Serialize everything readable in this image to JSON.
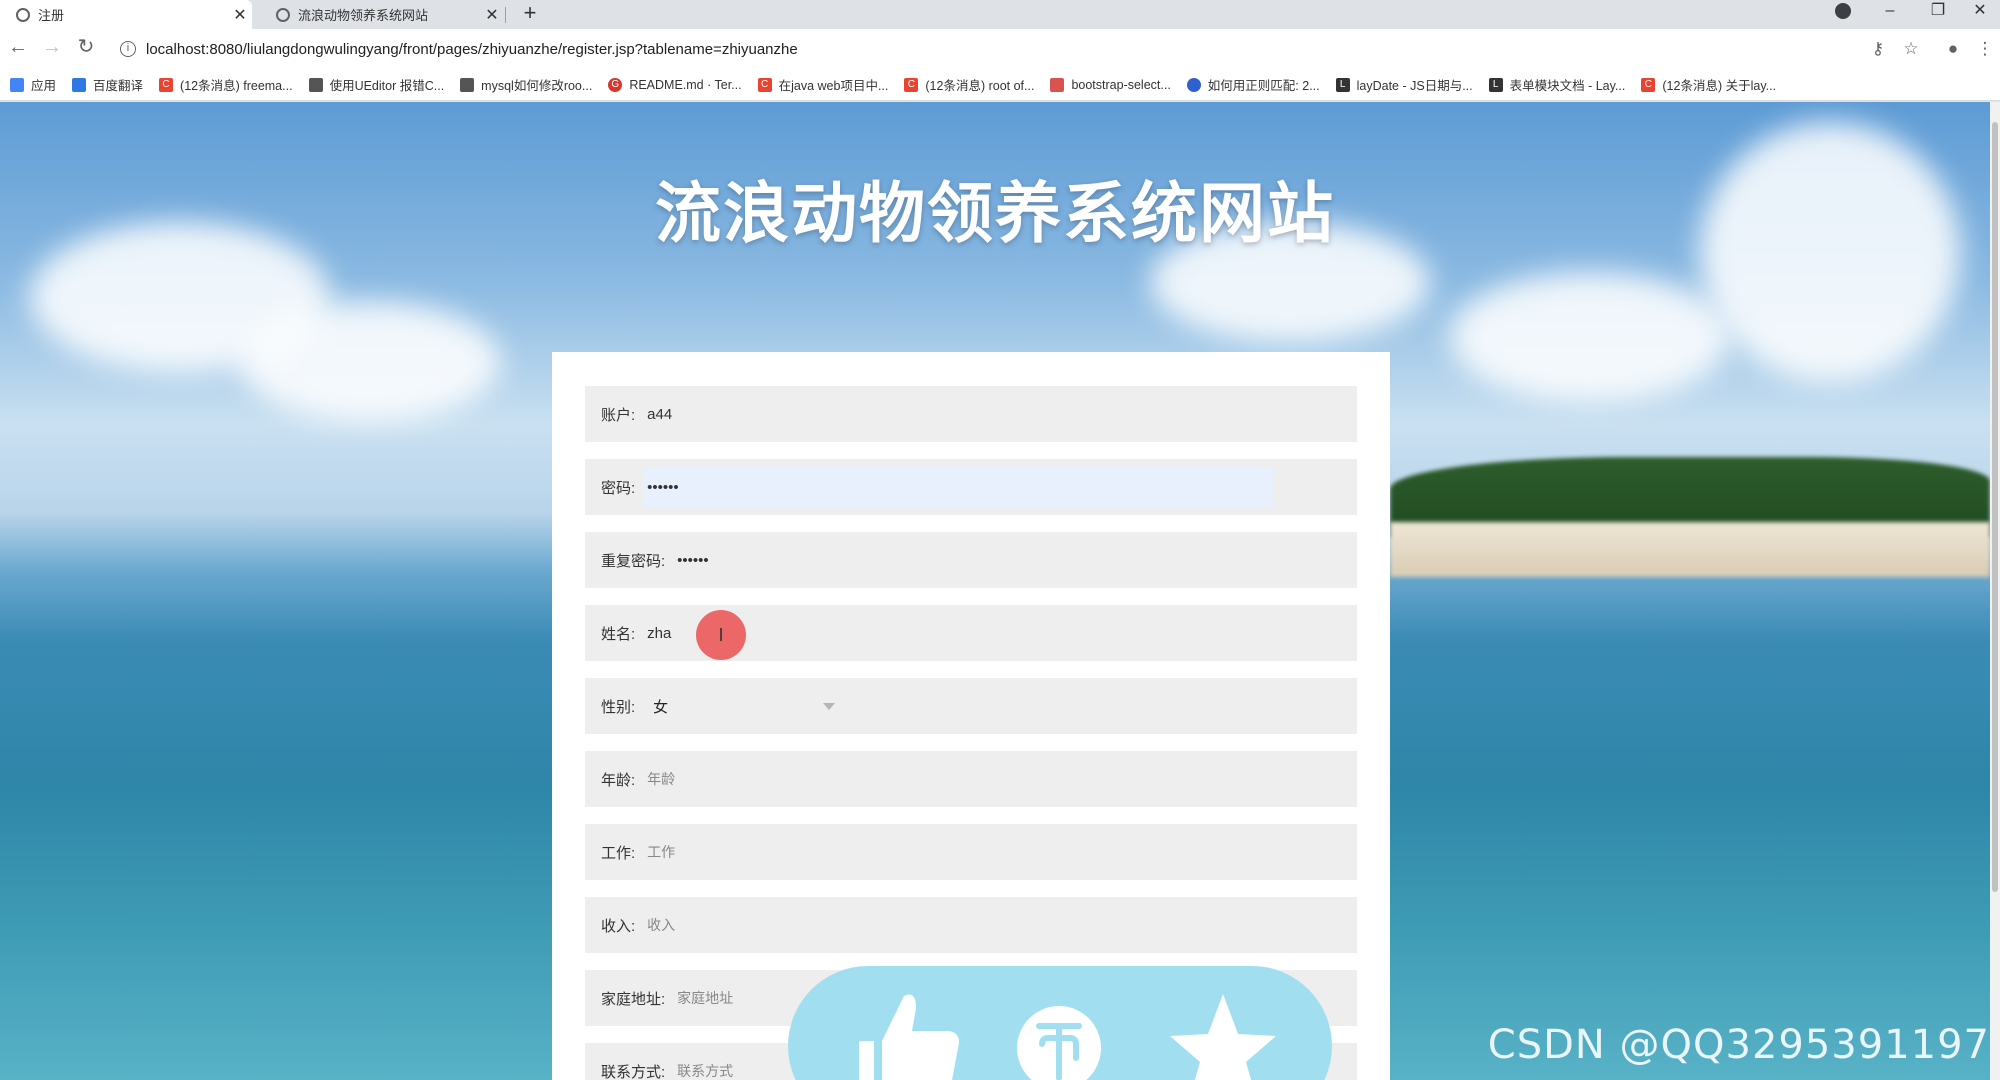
{
  "browser": {
    "tabs": [
      {
        "title": "注册",
        "active": true
      },
      {
        "title": "流浪动物领养系统网站",
        "active": false
      }
    ],
    "new_tab": "+",
    "url": "localhost:8080/liulangdongwulingyang/front/pages/zhiyuanzhe/register.jsp?tablename=zhiyuanzhe",
    "bookmarks": [
      {
        "label": "应用",
        "color": "#4285f4"
      },
      {
        "label": "百度翻译",
        "color": "#2e77e5"
      },
      {
        "label": "(12条消息) freema...",
        "color": "#e8442f"
      },
      {
        "label": "使用UEditor 报错C...",
        "color": "#555555"
      },
      {
        "label": "mysql如何修改roo...",
        "color": "#555555"
      },
      {
        "label": "README.md · Ter...",
        "color": "#d9362b"
      },
      {
        "label": "在java web项目中...",
        "color": "#e8442f"
      },
      {
        "label": "(12条消息) root of...",
        "color": "#e8442f"
      },
      {
        "label": "bootstrap-select...",
        "color": "#d9534f"
      },
      {
        "label": "如何用正则匹配: 2...",
        "color": "#3060d0"
      },
      {
        "label": "layDate - JS日期与...",
        "color": "#333333"
      },
      {
        "label": "表单模块文档 - Lay...",
        "color": "#333333"
      },
      {
        "label": "(12条消息) 关于lay...",
        "color": "#e8442f"
      }
    ]
  },
  "page": {
    "title": "流浪动物领养系统网站",
    "form": {
      "account": {
        "label": "账户:",
        "value": "a44"
      },
      "password": {
        "label": "密码:",
        "value": "••••••"
      },
      "repeat_password": {
        "label": "重复密码:",
        "value": "••••••"
      },
      "name": {
        "label": "姓名:",
        "value": "zha"
      },
      "gender": {
        "label": "性别:",
        "value": "女"
      },
      "age": {
        "label": "年龄:",
        "placeholder": "年龄"
      },
      "job": {
        "label": "工作:",
        "placeholder": "工作"
      },
      "income": {
        "label": "收入:",
        "placeholder": "收入"
      },
      "address": {
        "label": "家庭地址:",
        "placeholder": "家庭地址"
      },
      "contact": {
        "label": "联系方式:",
        "placeholder": "联系方式"
      }
    }
  },
  "overlay": {
    "cursor_glyph": "I",
    "reaction_icons": [
      "thumbs-up-icon",
      "coin-icon",
      "star-icon"
    ],
    "watermark": "CSDN @QQ3295391197"
  }
}
